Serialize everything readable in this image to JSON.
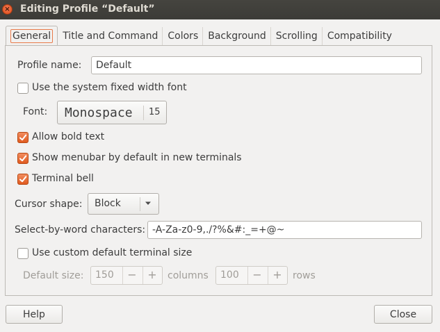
{
  "window": {
    "title": "Editing Profile “Default”",
    "close_glyph": "×"
  },
  "tabs": [
    {
      "label": "General",
      "active": true
    },
    {
      "label": "Title and Command",
      "active": false
    },
    {
      "label": "Colors",
      "active": false
    },
    {
      "label": "Background",
      "active": false
    },
    {
      "label": "Scrolling",
      "active": false
    },
    {
      "label": "Compatibility",
      "active": false
    }
  ],
  "general": {
    "profile_name_label": "Profile name:",
    "profile_name_value": "Default",
    "system_font_label": "Use the system fixed width font",
    "system_font_checked": false,
    "font_label": "Font:",
    "font_name": "Monospace",
    "font_size": "15",
    "allow_bold_label": "Allow bold text",
    "allow_bold_checked": true,
    "menubar_label": "Show menubar by default in new terminals",
    "menubar_checked": true,
    "bell_label": "Terminal bell",
    "bell_checked": true,
    "cursor_shape_label": "Cursor shape:",
    "cursor_shape_value": "Block",
    "word_chars_label": "Select-by-word characters:",
    "word_chars_value": "-A-Za-z0-9,./?%&#:_=+@~",
    "custom_size_label": "Use custom default terminal size",
    "custom_size_checked": false,
    "default_size_label": "Default size:",
    "columns_value": "150",
    "columns_label": "columns",
    "rows_value": "100",
    "rows_label": "rows",
    "minus_glyph": "−",
    "plus_glyph": "+"
  },
  "footer": {
    "help_label": "Help",
    "close_label": "Close"
  },
  "colors": {
    "accent": "#e05a1f",
    "titlebar": "#3c3b37",
    "window_bg": "#f2f1f0"
  },
  "icons": {
    "close": "close-icon",
    "check": "checkmark-icon",
    "dropdown": "chevron-down-icon"
  }
}
